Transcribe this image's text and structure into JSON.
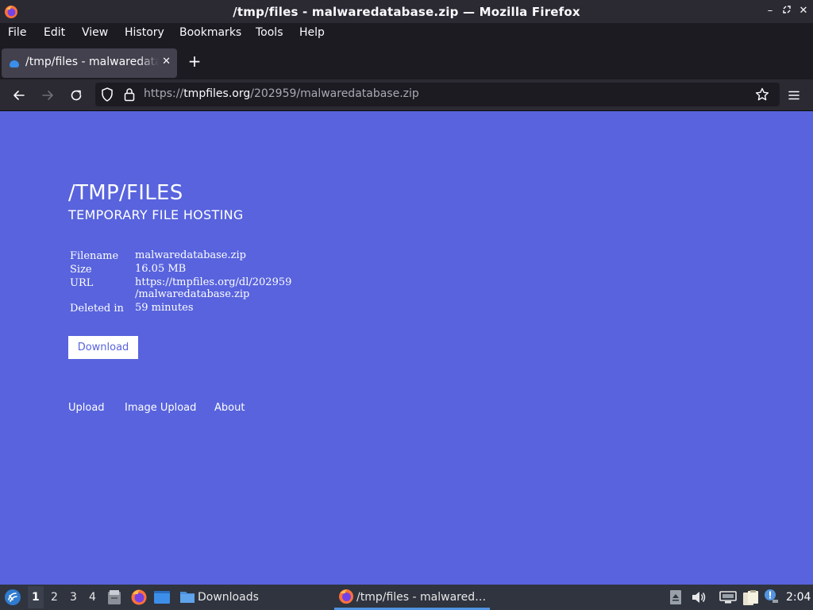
{
  "window": {
    "title": "/tmp/files - malwaredatabase.zip — Mozilla Firefox"
  },
  "menu": {
    "items": [
      "File",
      "Edit",
      "View",
      "History",
      "Bookmarks",
      "Tools",
      "Help"
    ]
  },
  "tabs": [
    {
      "label": "/tmp/files - malwaredatabase.zip",
      "active": true
    }
  ],
  "navbar": {
    "url_scheme": "https://",
    "url_host": "tmpfiles.org",
    "url_path": "/202959/malwaredatabase.zip"
  },
  "page": {
    "site_title": "/TMP/FILES",
    "site_subtitle": "TEMPORARY FILE HOSTING",
    "file_info": [
      {
        "label": "Filename",
        "value": "malwaredatabase.zip"
      },
      {
        "label": "Size",
        "value": "16.05 MB"
      },
      {
        "label": "URL",
        "value": "https://tmpfiles.org/dl/202959",
        "value_line2": "/malwaredatabase.zip"
      },
      {
        "label": "Deleted in",
        "value": "59 minutes"
      }
    ],
    "download_label": "Download",
    "footer_links": [
      "Upload",
      "Image Upload",
      "About"
    ],
    "background_color": "#5863dd"
  },
  "taskbar": {
    "workspaces": [
      "1",
      "2",
      "3",
      "4"
    ],
    "active_workspace": "1",
    "tasks": [
      {
        "label": "Downloads",
        "icon": "folder-icon"
      },
      {
        "label": "/tmp/files - malwared…",
        "icon": "firefox-icon",
        "active": true
      }
    ],
    "clock": "2:04"
  }
}
